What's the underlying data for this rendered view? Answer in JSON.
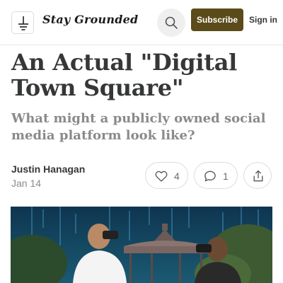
{
  "header": {
    "publication_name": "Stay Grounded",
    "subscribe_label": "Subscribe",
    "signin_label": "Sign in",
    "search_icon": "search-icon",
    "logo_icon": "ground-symbol-logo"
  },
  "post": {
    "title": "An Actual \"Digital Town Square\"",
    "subtitle": "What might a publicly owned social media platform look like?",
    "author": "Justin Hanagan",
    "date": "Jan 14",
    "likes": "4",
    "comments": "1",
    "hero_image": "two people wearing VR headsets in a park with a gazebo and digital rain"
  },
  "colors": {
    "accent": "#5b4b1a",
    "text": "#363737",
    "muted": "#8a8a8a",
    "border": "#dcdcdc"
  }
}
